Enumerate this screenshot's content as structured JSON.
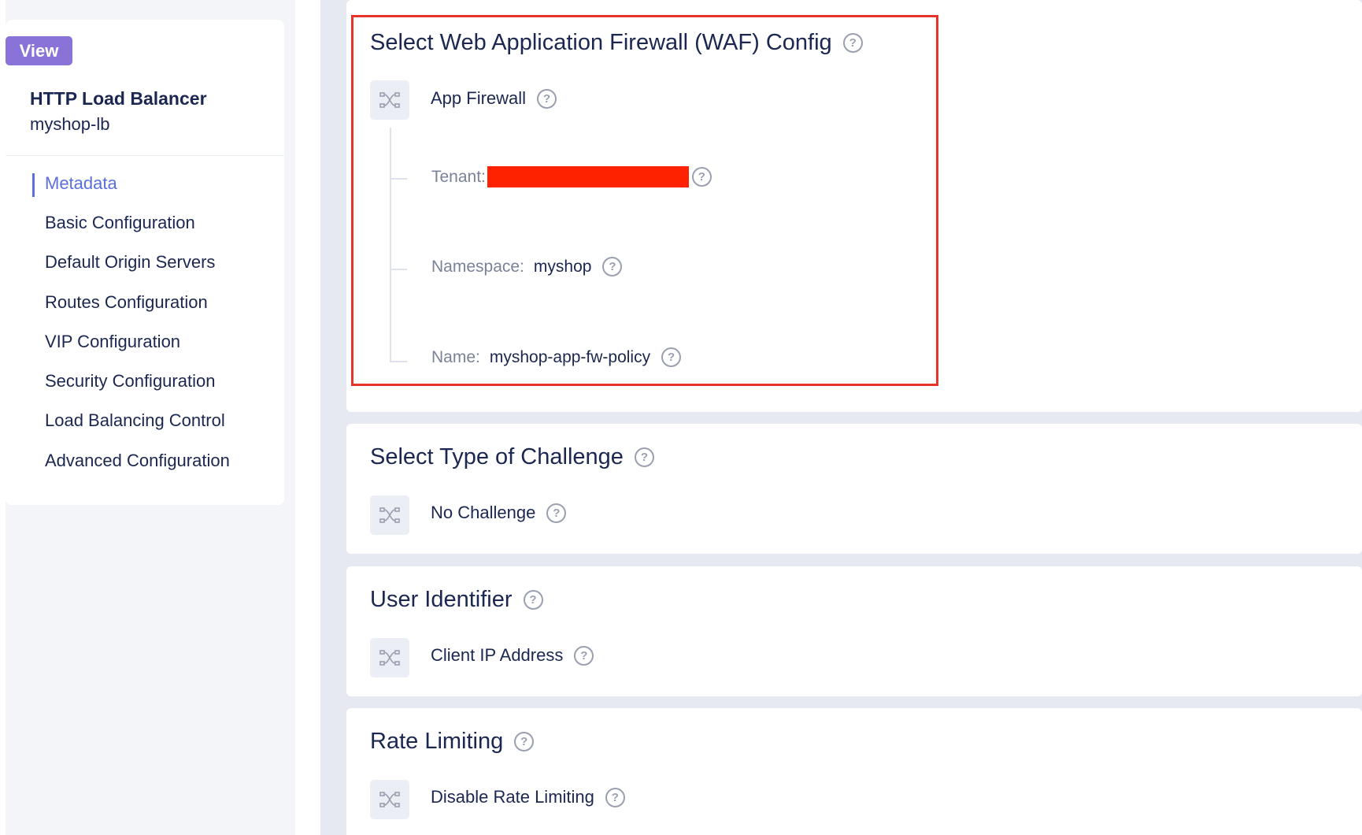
{
  "sidebar": {
    "badge": "View",
    "object_kind": "HTTP Load Balancer",
    "object_name": "myshop-lb",
    "nav": [
      {
        "label": "Metadata",
        "active": true
      },
      {
        "label": "Basic Configuration",
        "active": false
      },
      {
        "label": "Default Origin Servers",
        "active": false
      },
      {
        "label": "Routes Configuration",
        "active": false
      },
      {
        "label": "VIP Configuration",
        "active": false
      },
      {
        "label": "Security Configuration",
        "active": false
      },
      {
        "label": "Load Balancing Control",
        "active": false
      },
      {
        "label": "Advanced Configuration",
        "active": false
      }
    ]
  },
  "sections": {
    "waf": {
      "title": "Select Web Application Firewall (WAF) Config",
      "choice": "App Firewall",
      "tenant_label": "Tenant:",
      "namespace_label": "Namespace:",
      "namespace_value": "myshop",
      "name_label": "Name:",
      "name_value": "myshop-app-fw-policy"
    },
    "challenge": {
      "title": "Select Type of Challenge",
      "choice": "No Challenge"
    },
    "user_identifier": {
      "title": "User Identifier",
      "choice": "Client IP Address"
    },
    "rate_limiting": {
      "title": "Rate Limiting",
      "choice": "Disable Rate Limiting"
    }
  },
  "help_glyph": "?",
  "colors": {
    "accent": "#5b6fe0",
    "badge": "#8a73d8",
    "highlight_box": "#e8332a",
    "redaction": "#ff2200",
    "text": "#1b2750",
    "muted": "#7a8297"
  },
  "icons": {
    "object": "shuffle-icon",
    "help": "help-circle-icon"
  }
}
